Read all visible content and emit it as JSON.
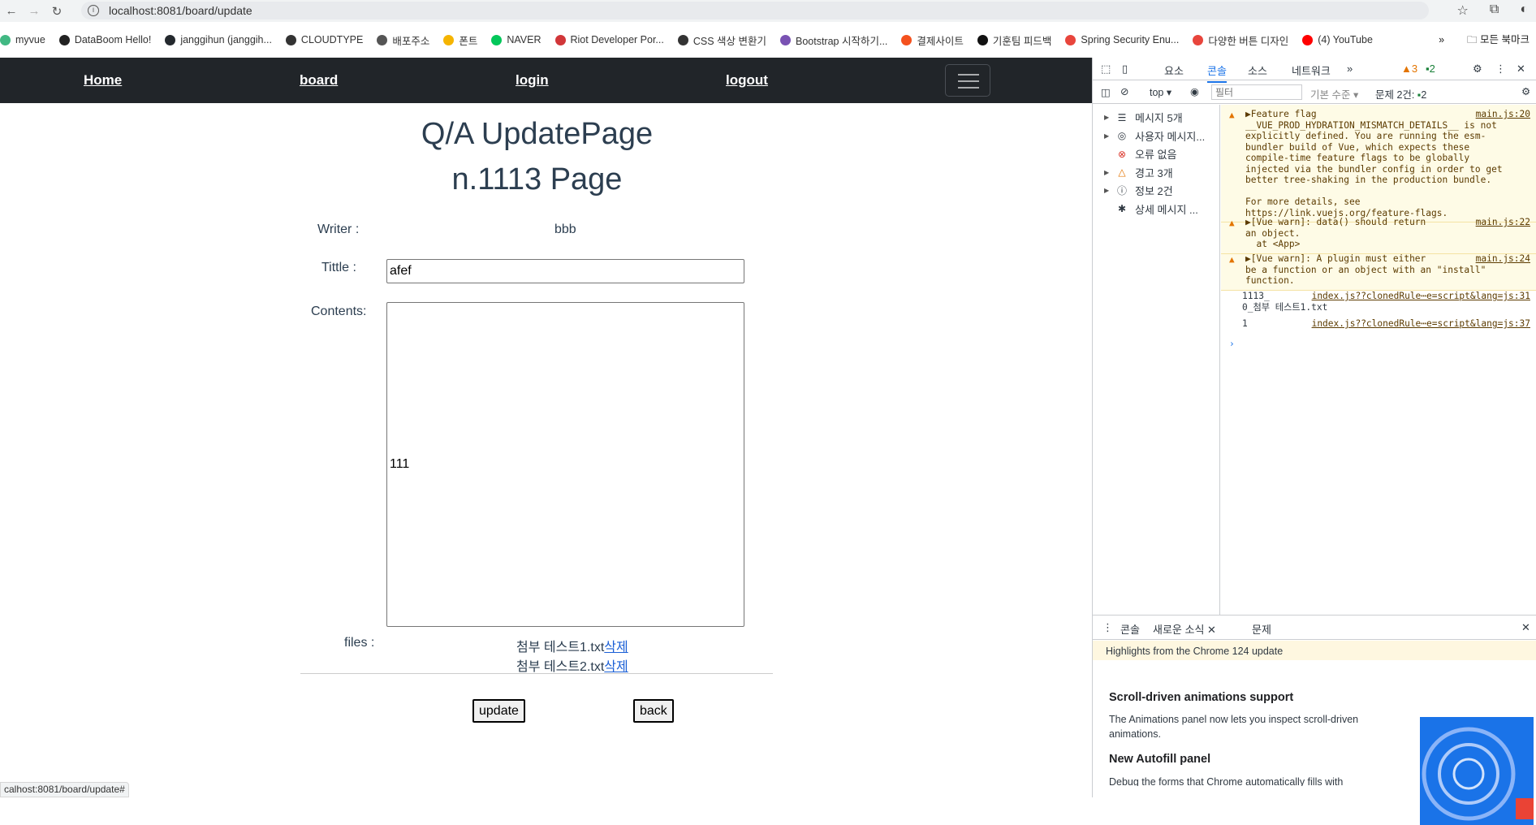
{
  "browser": {
    "url": "localhost:8081/board/update",
    "bookmarks": [
      "myvue",
      "DataBoom Hello!",
      "janggihun (janggih...",
      "CLOUDTYPE",
      "배포주소",
      "폰트",
      "NAVER",
      "Riot Developer Por...",
      "CSS 색상 변환기",
      "Bootstrap 시작하기...",
      "결제사이트",
      "기훈팀 피드백",
      "Spring Security Enu...",
      "다양한 버튼 디자인",
      "(4) YouTube"
    ],
    "bookmarks_more": "»",
    "all_bookmarks": "모든 북마크",
    "status_url": "calhost:8081/board/update#"
  },
  "nav": {
    "home": "Home",
    "board": "board",
    "login": "login",
    "logout": "logout"
  },
  "page": {
    "title_line1": "Q/A UpdatePage",
    "title_line2": "n.1113 Page",
    "writer_label": "Writer :",
    "writer_value": "bbb",
    "title_label": "Tittle :",
    "title_value": "afef",
    "contents_label": "Contents:",
    "contents_value": "111",
    "files_label": "files :",
    "files": [
      {
        "name": "첨부 테스트1.txt",
        "delete": "삭제"
      },
      {
        "name": "첨부 테스트2.txt",
        "delete": "삭제"
      }
    ],
    "update_button": "update",
    "back_button": "back"
  },
  "devtools": {
    "tabs": [
      "요소",
      "콘솔",
      "소스",
      "네트워크"
    ],
    "active_tab": "콘솔",
    "warn_count": "3",
    "msg_count": "2",
    "context": "top",
    "filter_placeholder": "필터",
    "level": "기본 수준",
    "issues": "문제 2건:",
    "issues_count": "2",
    "sidebar": [
      {
        "label": "메시지 5개",
        "icon": "list-icon"
      },
      {
        "label": "사용자 메시지...",
        "icon": "user-icon"
      },
      {
        "label": "오류 없음",
        "icon": "error-icon"
      },
      {
        "label": "경고 3개",
        "icon": "warning-icon"
      },
      {
        "label": "정보 2건",
        "icon": "info-icon"
      },
      {
        "label": "상세 메시지 ...",
        "icon": "bug-icon"
      }
    ],
    "console": [
      {
        "type": "warn",
        "source": "main.js:20",
        "text": "▶Feature flag\n__VUE_PROD_HYDRATION_MISMATCH_DETAILS__ is not\nexplicitly defined. You are running the esm-\nbundler build of Vue, which expects these\ncompile-time feature flags to be globally\ninjected via the bundler config in order to get\nbetter tree-shaking in the production bundle.\n\nFor more details, see\nhttps://link.vuejs.org/feature-flags."
      },
      {
        "type": "warn",
        "source": "main.js:22",
        "text": "▶[Vue warn]: data() should return\nan object.\n  at <App>"
      },
      {
        "type": "warn",
        "source": "main.js:24",
        "text": "▶[Vue warn]: A plugin must either\nbe a function or an object with an \"install\"\nfunction."
      },
      {
        "type": "log",
        "source": "index.js??clonedRule⋯e=script&lang=js:31",
        "text": "1113_\n0_첨부 테스트1.txt"
      },
      {
        "type": "log",
        "source": "index.js??clonedRule⋯e=script&lang=js:37",
        "text": "1"
      }
    ],
    "prompt": "›",
    "drawer_tabs": [
      "콘솔",
      "새로운 소식",
      "문제"
    ],
    "drawer_active": "새로운 소식",
    "highlights": "Highlights from the Chrome 124 update",
    "wn1_title": "Scroll-driven animations support",
    "wn1_text": "The Animations panel now lets you inspect scroll-driven animations.",
    "wn2_title": "New Autofill panel",
    "wn2_text": "Debug the forms that Chrome automatically fills with"
  },
  "colors": {
    "navbar": "#212529",
    "link": "#1a5fd6",
    "console_warn_bg": "#fefbe6",
    "heading": "#2c3e50"
  }
}
